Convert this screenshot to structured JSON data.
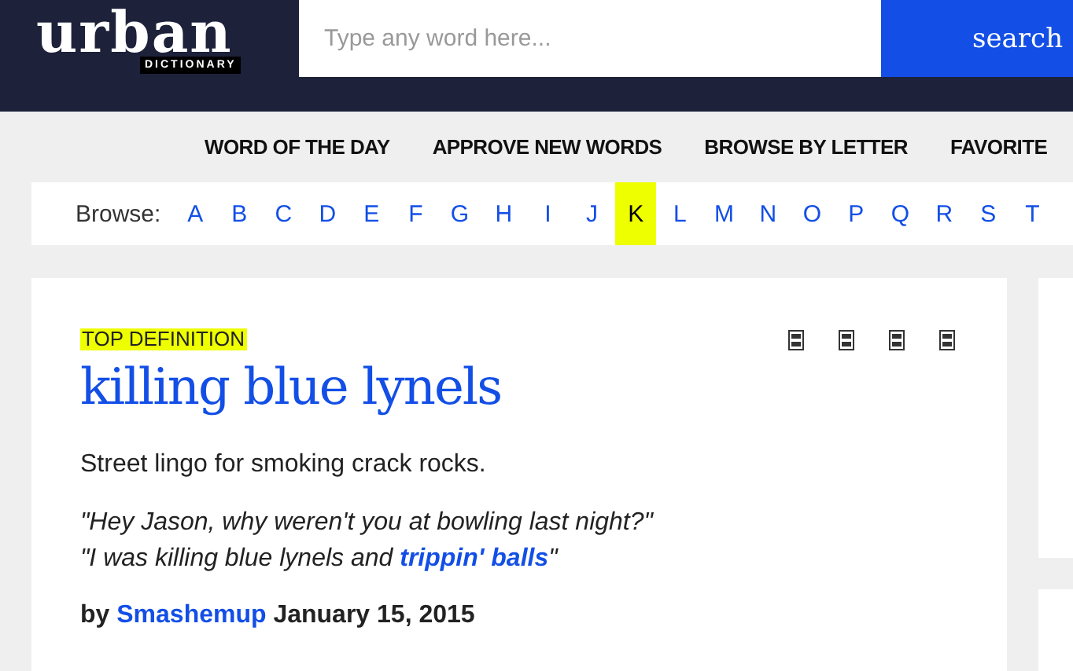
{
  "header": {
    "logo": {
      "word": "urban",
      "subtitle": "DICTIONARY"
    },
    "search": {
      "placeholder": "Type any word here..."
    },
    "search_button": "search"
  },
  "nav": [
    "WORD OF THE DAY",
    "APPROVE NEW WORDS",
    "BROWSE BY LETTER",
    "FAVORITE"
  ],
  "browse": {
    "label": "Browse:",
    "letters": [
      {
        "letter": "A",
        "selected": false
      },
      {
        "letter": "B",
        "selected": false
      },
      {
        "letter": "C",
        "selected": false
      },
      {
        "letter": "D",
        "selected": false
      },
      {
        "letter": "E",
        "selected": false
      },
      {
        "letter": "F",
        "selected": false
      },
      {
        "letter": "G",
        "selected": false
      },
      {
        "letter": "H",
        "selected": false
      },
      {
        "letter": "I",
        "selected": false
      },
      {
        "letter": "J",
        "selected": false
      },
      {
        "letter": "K",
        "selected": true
      },
      {
        "letter": "L",
        "selected": false
      },
      {
        "letter": "M",
        "selected": false
      },
      {
        "letter": "N",
        "selected": false
      },
      {
        "letter": "O",
        "selected": false
      },
      {
        "letter": "P",
        "selected": false
      },
      {
        "letter": "Q",
        "selected": false
      },
      {
        "letter": "R",
        "selected": false
      },
      {
        "letter": "S",
        "selected": false
      },
      {
        "letter": "T",
        "selected": false
      }
    ]
  },
  "definition": {
    "badge": "TOP DEFINITION",
    "word": "killing blue lynels",
    "meaning": "Street lingo for smoking crack rocks.",
    "example": [
      [
        {
          "kind": "text",
          "text": "\"Hey Jason, why weren't you at bowling last night?\""
        }
      ],
      [
        {
          "kind": "text",
          "text": "\"I was killing blue lynels and "
        },
        {
          "kind": "link",
          "text": "trippin' balls"
        },
        {
          "kind": "text",
          "text": "\""
        }
      ]
    ],
    "byline": [
      {
        "kind": "text",
        "text": "by "
      },
      {
        "kind": "link",
        "text": "Smashemup"
      },
      {
        "kind": "text",
        "text": " January 15, 2015"
      }
    ]
  }
}
